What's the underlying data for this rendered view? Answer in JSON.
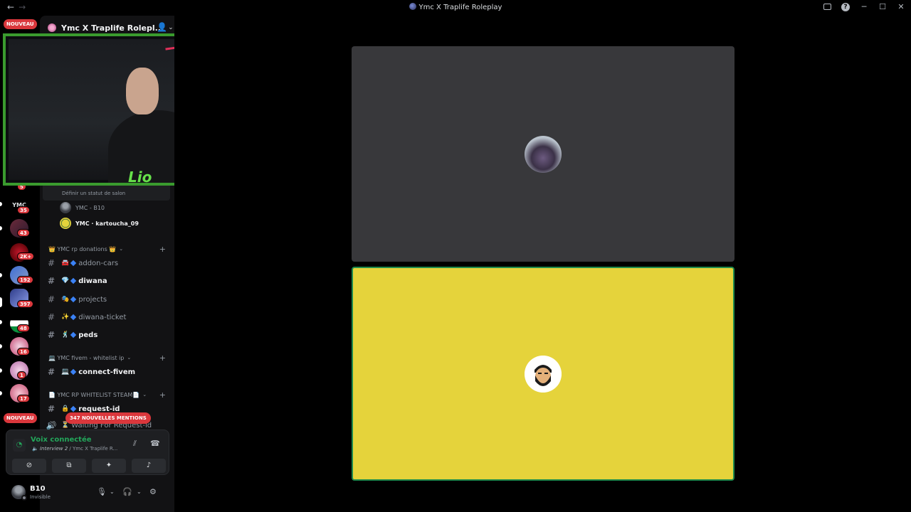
{
  "titlebar": {
    "back_icon": "arrow-left-icon",
    "forward_icon": "arrow-right-icon",
    "title": "Ymc X Traplife Roleplay"
  },
  "rail": {
    "new_top": "NOUVEAU",
    "new_bottom": "NOUVEAU",
    "counts": [
      "5",
      "35",
      "43",
      "2K+",
      "192",
      "397",
      "48",
      "16",
      "1",
      "17"
    ],
    "letters_logo": "YMC"
  },
  "sidebar": {
    "server_name": "Ymc X Traplife Rolepl...",
    "vc_status_title": "Interview 2",
    "vc_status_sub": "Définir un statut de salon",
    "voice_users": [
      {
        "name": "YMC - B10"
      },
      {
        "name": "YMC · kartoucha_09"
      }
    ],
    "categories": [
      {
        "label": "👑 YMC rp donations 👑"
      },
      {
        "label": "💻 YMC fivem - whitelist ip"
      },
      {
        "label": "📄 YMC RP WHITELIST STEAM📄"
      }
    ],
    "channels": [
      {
        "emoji": "🚘",
        "label": "addon-cars"
      },
      {
        "emoji": "💎",
        "label": "diwana"
      },
      {
        "emoji": "🎭",
        "label": "projects"
      },
      {
        "emoji": "✨",
        "label": "diwana-ticket"
      },
      {
        "emoji": "🕺",
        "label": "peds"
      },
      {
        "emoji": "💻",
        "label": "connect-fivem"
      },
      {
        "emoji": "🔒",
        "label": "request-id"
      },
      {
        "emoji": "⏳",
        "label": "Waiting For Request-id"
      }
    ],
    "mentions_badge": "347 NOUVELLES MENTIONS"
  },
  "voice_panel": {
    "title": "Voix connectée",
    "channel": "Interview 2",
    "server": " / Ymc X Traplife R..."
  },
  "userbar": {
    "username": "B10",
    "status": "Invisible"
  },
  "cam": {
    "overlay_text": "Lio"
  },
  "colors": {
    "accent_green": "#23a55a",
    "cam_border": "#3a9b2e",
    "tile_yellow": "#e5d33b",
    "tile_gray": "#38383b",
    "badge_red": "#da373c"
  }
}
